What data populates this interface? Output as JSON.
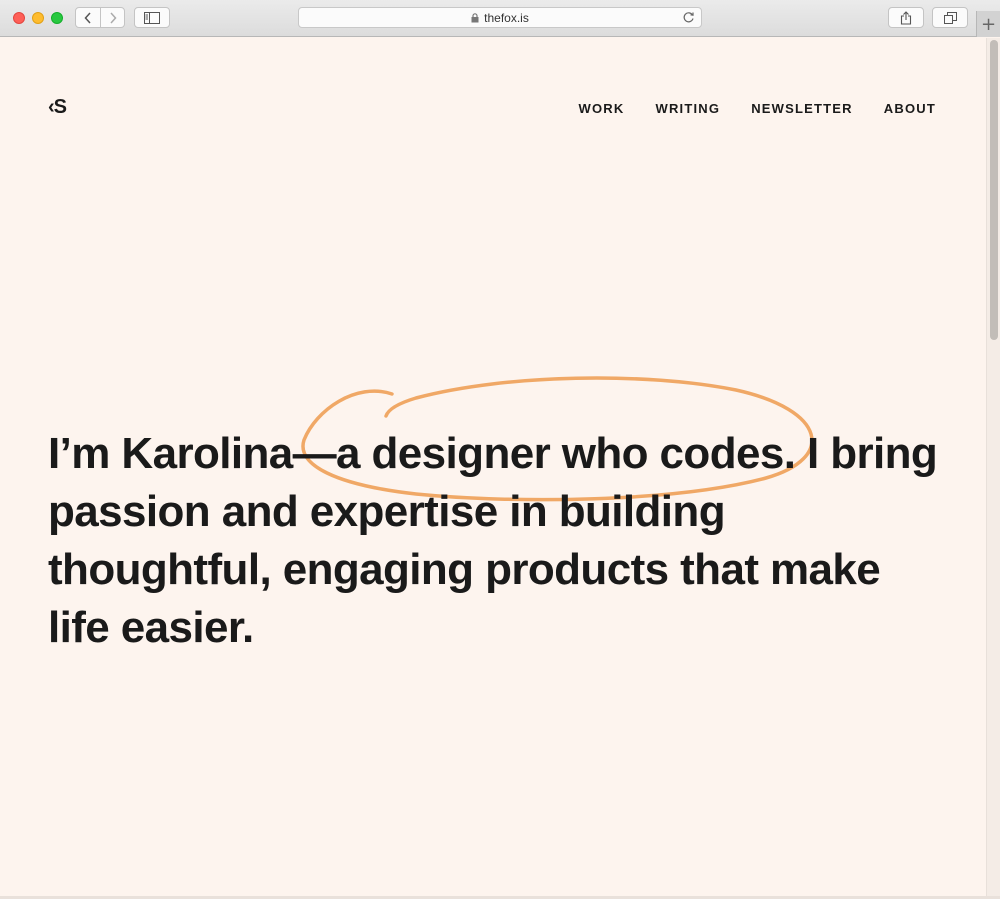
{
  "browser": {
    "url": "thefox.is",
    "new_tab_symbol": "+"
  },
  "site": {
    "logo": "‹S",
    "nav": [
      "WORK",
      "WRITING",
      "NEWSLETTER",
      "ABOUT"
    ],
    "hero_text": "I’m Karolina—a designer who codes. I bring passion and expertise in building thoughtful, engaging products that make life easier."
  },
  "colors": {
    "background": "#fdf4ee",
    "text": "#1a1a1a",
    "accent_scribble": "#f0a866"
  }
}
